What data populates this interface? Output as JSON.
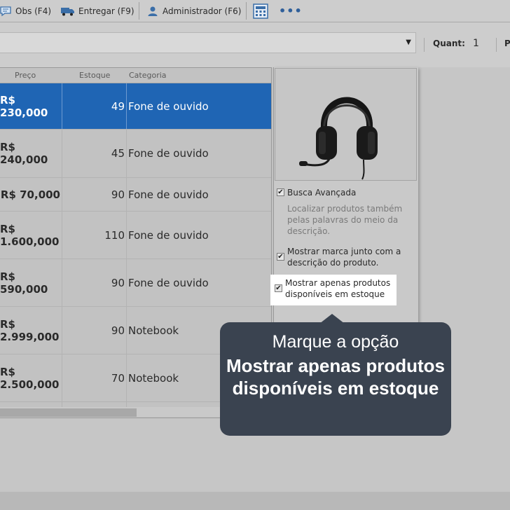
{
  "toolbar": {
    "obs_label": "Obs (F4)",
    "entregar_label": "Entregar (F9)",
    "admin_label": "Administrador (F6)",
    "more_label": "•••"
  },
  "search": {
    "value": "",
    "dropdown_arrow": "▼"
  },
  "quant": {
    "label": "Quant:",
    "value": "1",
    "next_label": "P"
  },
  "table": {
    "headers": {
      "preco": "Preço",
      "estoque": "Estoque",
      "categoria": "Categoria"
    },
    "rows": [
      {
        "preco": "R$ 230,000",
        "estoque": "49",
        "categoria": "Fone de ouvido"
      },
      {
        "preco": "R$ 240,000",
        "estoque": "45",
        "categoria": "Fone de ouvido"
      },
      {
        "preco": "R$ 70,000",
        "estoque": "90",
        "categoria": "Fone de ouvido"
      },
      {
        "preco": "R$ 1.600,000",
        "estoque": "110",
        "categoria": "Fone de ouvido"
      },
      {
        "preco": "R$ 590,000",
        "estoque": "90",
        "categoria": "Fone de ouvido"
      },
      {
        "preco": "R$ 2.999,000",
        "estoque": "90",
        "categoria": "Notebook"
      },
      {
        "preco": "R$ 2.500,000",
        "estoque": "70",
        "categoria": "Notebook"
      }
    ]
  },
  "options": {
    "busca_label": "Busca Avançada",
    "busca_desc": "Localizar produtos também pelas palavras do meio da descrição.",
    "marca_label": "Mostrar marca junto com a descrição do produto.",
    "disponiveis_label": "Mostrar apenas produtos disponíveis em estoque",
    "check_mark": "✔"
  },
  "callout": {
    "line1": "Marque a opção",
    "bold": "Mostrar apenas produtos disponíveis em estoque"
  },
  "colors": {
    "selection": "#1f65b4",
    "callout_bg": "#3a4350"
  }
}
